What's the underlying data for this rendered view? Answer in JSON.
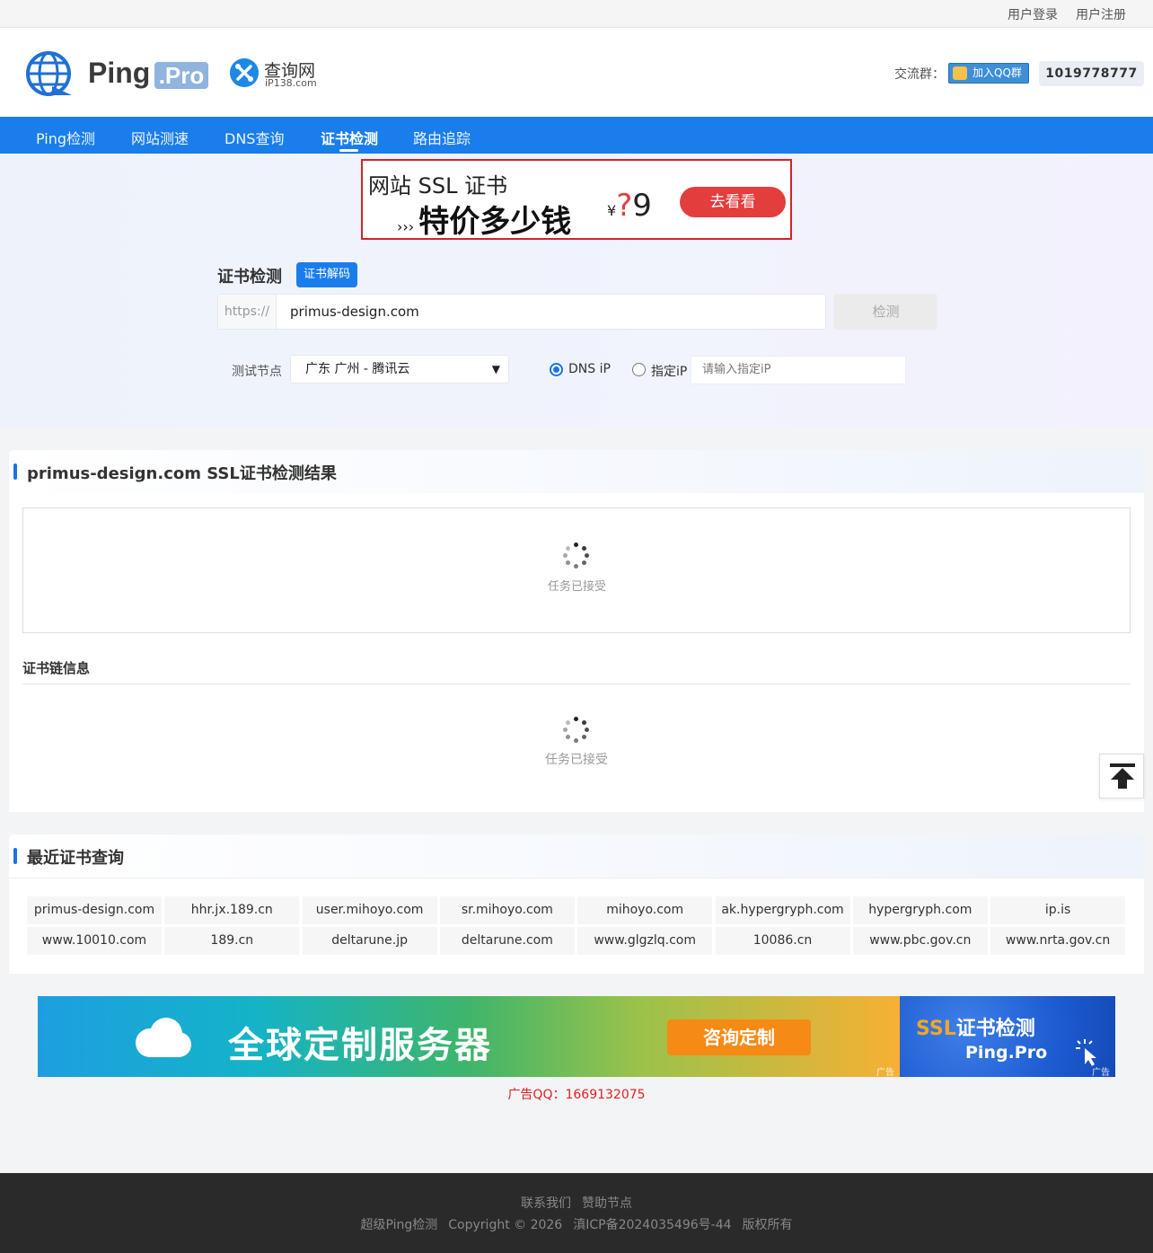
{
  "topbar": {
    "login": "用户登录",
    "register": "用户注册"
  },
  "header": {
    "logo_text": "Ping",
    "logo_badge": ".Pro",
    "partner_name": "查询网",
    "partner_domain": "iP138.com",
    "group_label": "交流群：",
    "qq_button": "加入QQ群",
    "qq_number": "1019778777"
  },
  "nav": {
    "items": [
      "Ping检测",
      "网站测速",
      "DNS查询",
      "证书检测",
      "路由追踪"
    ],
    "active": "证书检测"
  },
  "ad_top": {
    "line1": "网站 SSL 证书",
    "line2": "特价多少钱",
    "price_symbol": "¥",
    "price_q": "?",
    "price_tail": "9",
    "button": "去看看"
  },
  "form": {
    "title": "证书检测",
    "decode_button": "证书解码",
    "url_prefix": "https://",
    "url_value": "primus-design.com",
    "check_button": "检测",
    "node_label": "测试节点",
    "node_selected": "广东 广州 - 腾讯云",
    "radio_dns": "DNS iP",
    "radio_ip": "指定iP",
    "ip_placeholder": "请输入指定iP"
  },
  "result": {
    "title": "primus-design.com SSL证书检测结果",
    "status_text": "任务已接受",
    "chain_title": "证书链信息",
    "chain_status_text": "任务已接受"
  },
  "recent": {
    "title": "最近证书查询",
    "rows": [
      [
        "primus-design.com",
        "hhr.jx.189.cn",
        "user.mihoyo.com",
        "sr.mihoyo.com",
        "mihoyo.com",
        "ak.hypergryph.com",
        "hypergryph.com",
        "ip.is"
      ],
      [
        "www.10010.com",
        "189.cn",
        "deltarune.jp",
        "deltarune.com",
        "www.glgzlq.com",
        "10086.cn",
        "www.pbc.gov.cn",
        "www.nrta.gov.cn"
      ]
    ]
  },
  "ad_bottom": {
    "text": "全球定制服务器",
    "button": "咨询定制",
    "tag": "广告",
    "side_ssl": "SSL",
    "side_title": "证书检测",
    "side_brand": "Ping.Pro",
    "side_tag": "广告"
  },
  "ad_contact": "广告QQ：1669132075",
  "footer": {
    "links": [
      "联系我们",
      "赞助节点"
    ],
    "copy": [
      "超级Ping检测",
      "Copyright © 2026",
      "滇ICP备2024035496号-44",
      "版权所有"
    ]
  },
  "colors": {
    "accent": "#1a7dec",
    "ad_red": "#e43d3d",
    "footer_bg": "#2a2a2a"
  }
}
